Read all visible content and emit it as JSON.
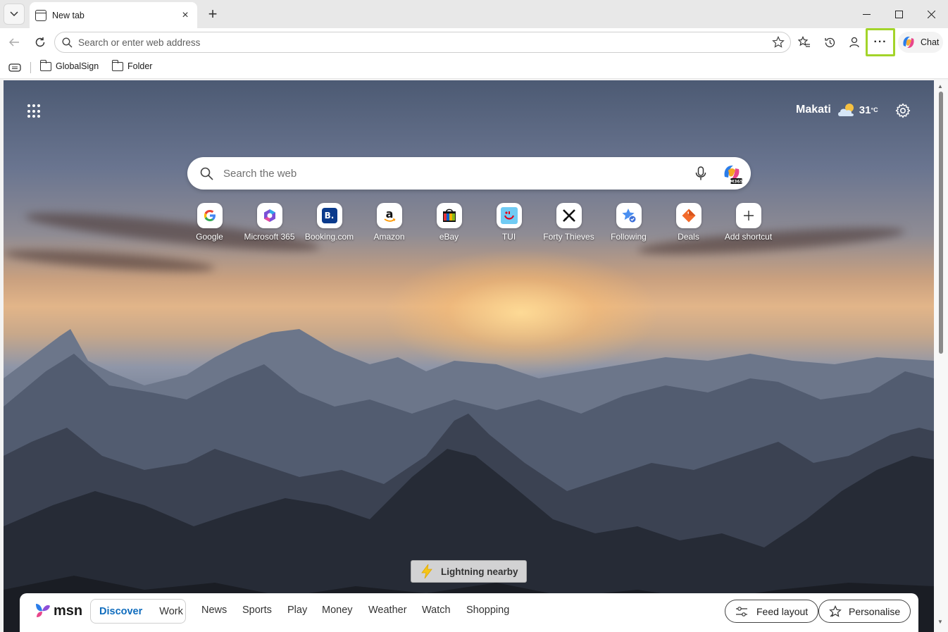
{
  "browser": {
    "tab": {
      "title": "New tab",
      "close_glyph": "×"
    },
    "new_tab_glyph": "+",
    "window_controls": {
      "minimize": "—",
      "maximize": "☐",
      "close": "✕"
    },
    "address_bar": {
      "placeholder": "Search or enter web address",
      "value": ""
    },
    "more_glyph": "···",
    "chat_label": "Chat",
    "favorites": [
      {
        "label": "GlobalSign",
        "icon": "folder-icon"
      },
      {
        "label": "Folder",
        "icon": "folder-icon"
      }
    ]
  },
  "newtab": {
    "weather": {
      "city": "Makati",
      "temp": "31",
      "unit": "°C",
      "icon": "partly-cloudy-icon"
    },
    "search": {
      "placeholder": "Search the web",
      "value": ""
    },
    "shortcuts": [
      {
        "label": "Google",
        "icon": "google-icon"
      },
      {
        "label": "Microsoft 365",
        "icon": "microsoft-365-icon"
      },
      {
        "label": "Booking.com",
        "icon": "booking-icon"
      },
      {
        "label": "Amazon",
        "icon": "amazon-icon"
      },
      {
        "label": "eBay",
        "icon": "ebay-icon"
      },
      {
        "label": "TUI",
        "icon": "tui-icon"
      },
      {
        "label": "Forty Thieves",
        "icon": "forty-thieves-icon"
      },
      {
        "label": "Following",
        "icon": "following-icon"
      },
      {
        "label": "Deals",
        "icon": "deals-icon"
      },
      {
        "label": "Add shortcut",
        "icon": "plus-icon"
      }
    ],
    "notification": {
      "text": "Lightning nearby",
      "icon": "lightning-icon"
    },
    "msn": {
      "logo_text": "msn",
      "segments": [
        "Discover",
        "Work"
      ],
      "active_segment": "Discover",
      "nav": [
        "News",
        "Sports",
        "Play",
        "Money",
        "Weather",
        "Watch",
        "Shopping"
      ],
      "feed_layout_label": "Feed layout",
      "personalise_label": "Personalise"
    }
  },
  "colors": {
    "highlight": "#a3d42a",
    "msn_active": "#0f6cbd"
  }
}
